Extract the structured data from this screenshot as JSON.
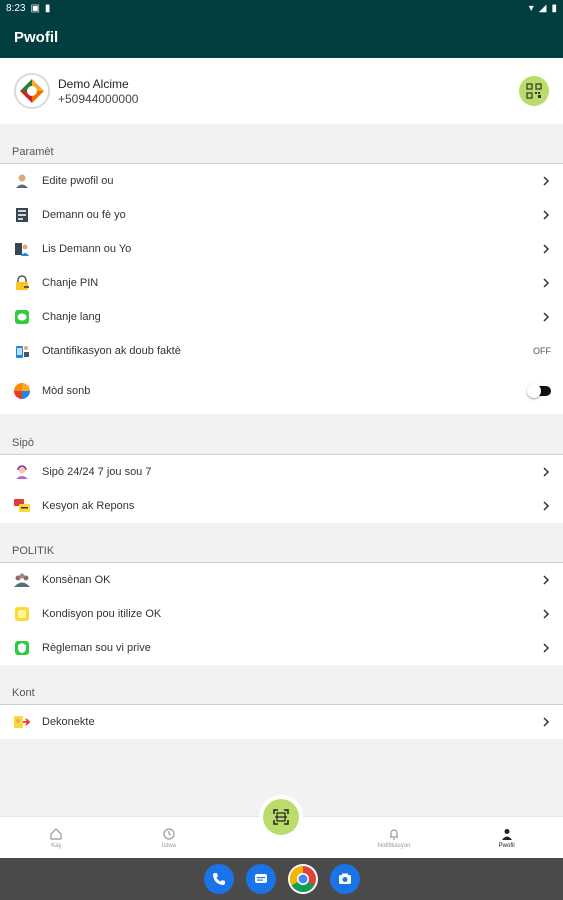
{
  "status_bar": {
    "time": "8:23"
  },
  "app_bar": {
    "title": "Pwofil"
  },
  "profile": {
    "name": "Demo Alcime",
    "phone": "+50944000000"
  },
  "sections": {
    "parametre": {
      "header": "Paramèt",
      "items": [
        {
          "label": "Edite pwofil ou",
          "icon": "user-edit-icon"
        },
        {
          "label": "Demann ou fè yo",
          "icon": "request-list-icon"
        },
        {
          "label": "Lis Demann ou Yo",
          "icon": "request-people-icon"
        },
        {
          "label": "Chanje PIN",
          "icon": "lock-icon"
        },
        {
          "label": "Chanje lang",
          "icon": "chat-bubble-icon"
        },
        {
          "label": "Otantifikasyon ak doub faktè",
          "icon": "two-factor-icon",
          "value": "OFF"
        },
        {
          "label": "Mòd sonb",
          "icon": "dark-mode-icon"
        }
      ]
    },
    "sipo": {
      "header": "Sipò",
      "items": [
        {
          "label": "Sipò 24/24 7 jou sou 7",
          "icon": "support-agent-icon"
        },
        {
          "label": " Kesyon ak Repons",
          "icon": "faq-icon"
        }
      ]
    },
    "politik": {
      "header": "POLITIK",
      "items": [
        {
          "label": "Konsènan OK",
          "icon": "about-icon"
        },
        {
          "label": "Kondisyon pou itilize OK",
          "icon": "terms-icon"
        },
        {
          "label": "Règleman sou vi prive",
          "icon": "privacy-shield-icon"
        }
      ]
    },
    "kont": {
      "header": "Kont",
      "items": [
        {
          "label": "Dekonekte",
          "icon": "logout-icon"
        }
      ]
    }
  },
  "bottom_nav": [
    {
      "label": "Kay",
      "icon": "home-icon"
    },
    {
      "label": "Istwa",
      "icon": "history-icon"
    },
    {
      "label": "Notifikasyon",
      "icon": "bell-icon"
    },
    {
      "label": "Pwofil",
      "icon": "person-icon",
      "active": true
    }
  ],
  "colors": {
    "primary": "#023e40",
    "accent": "#b9dc6a"
  }
}
